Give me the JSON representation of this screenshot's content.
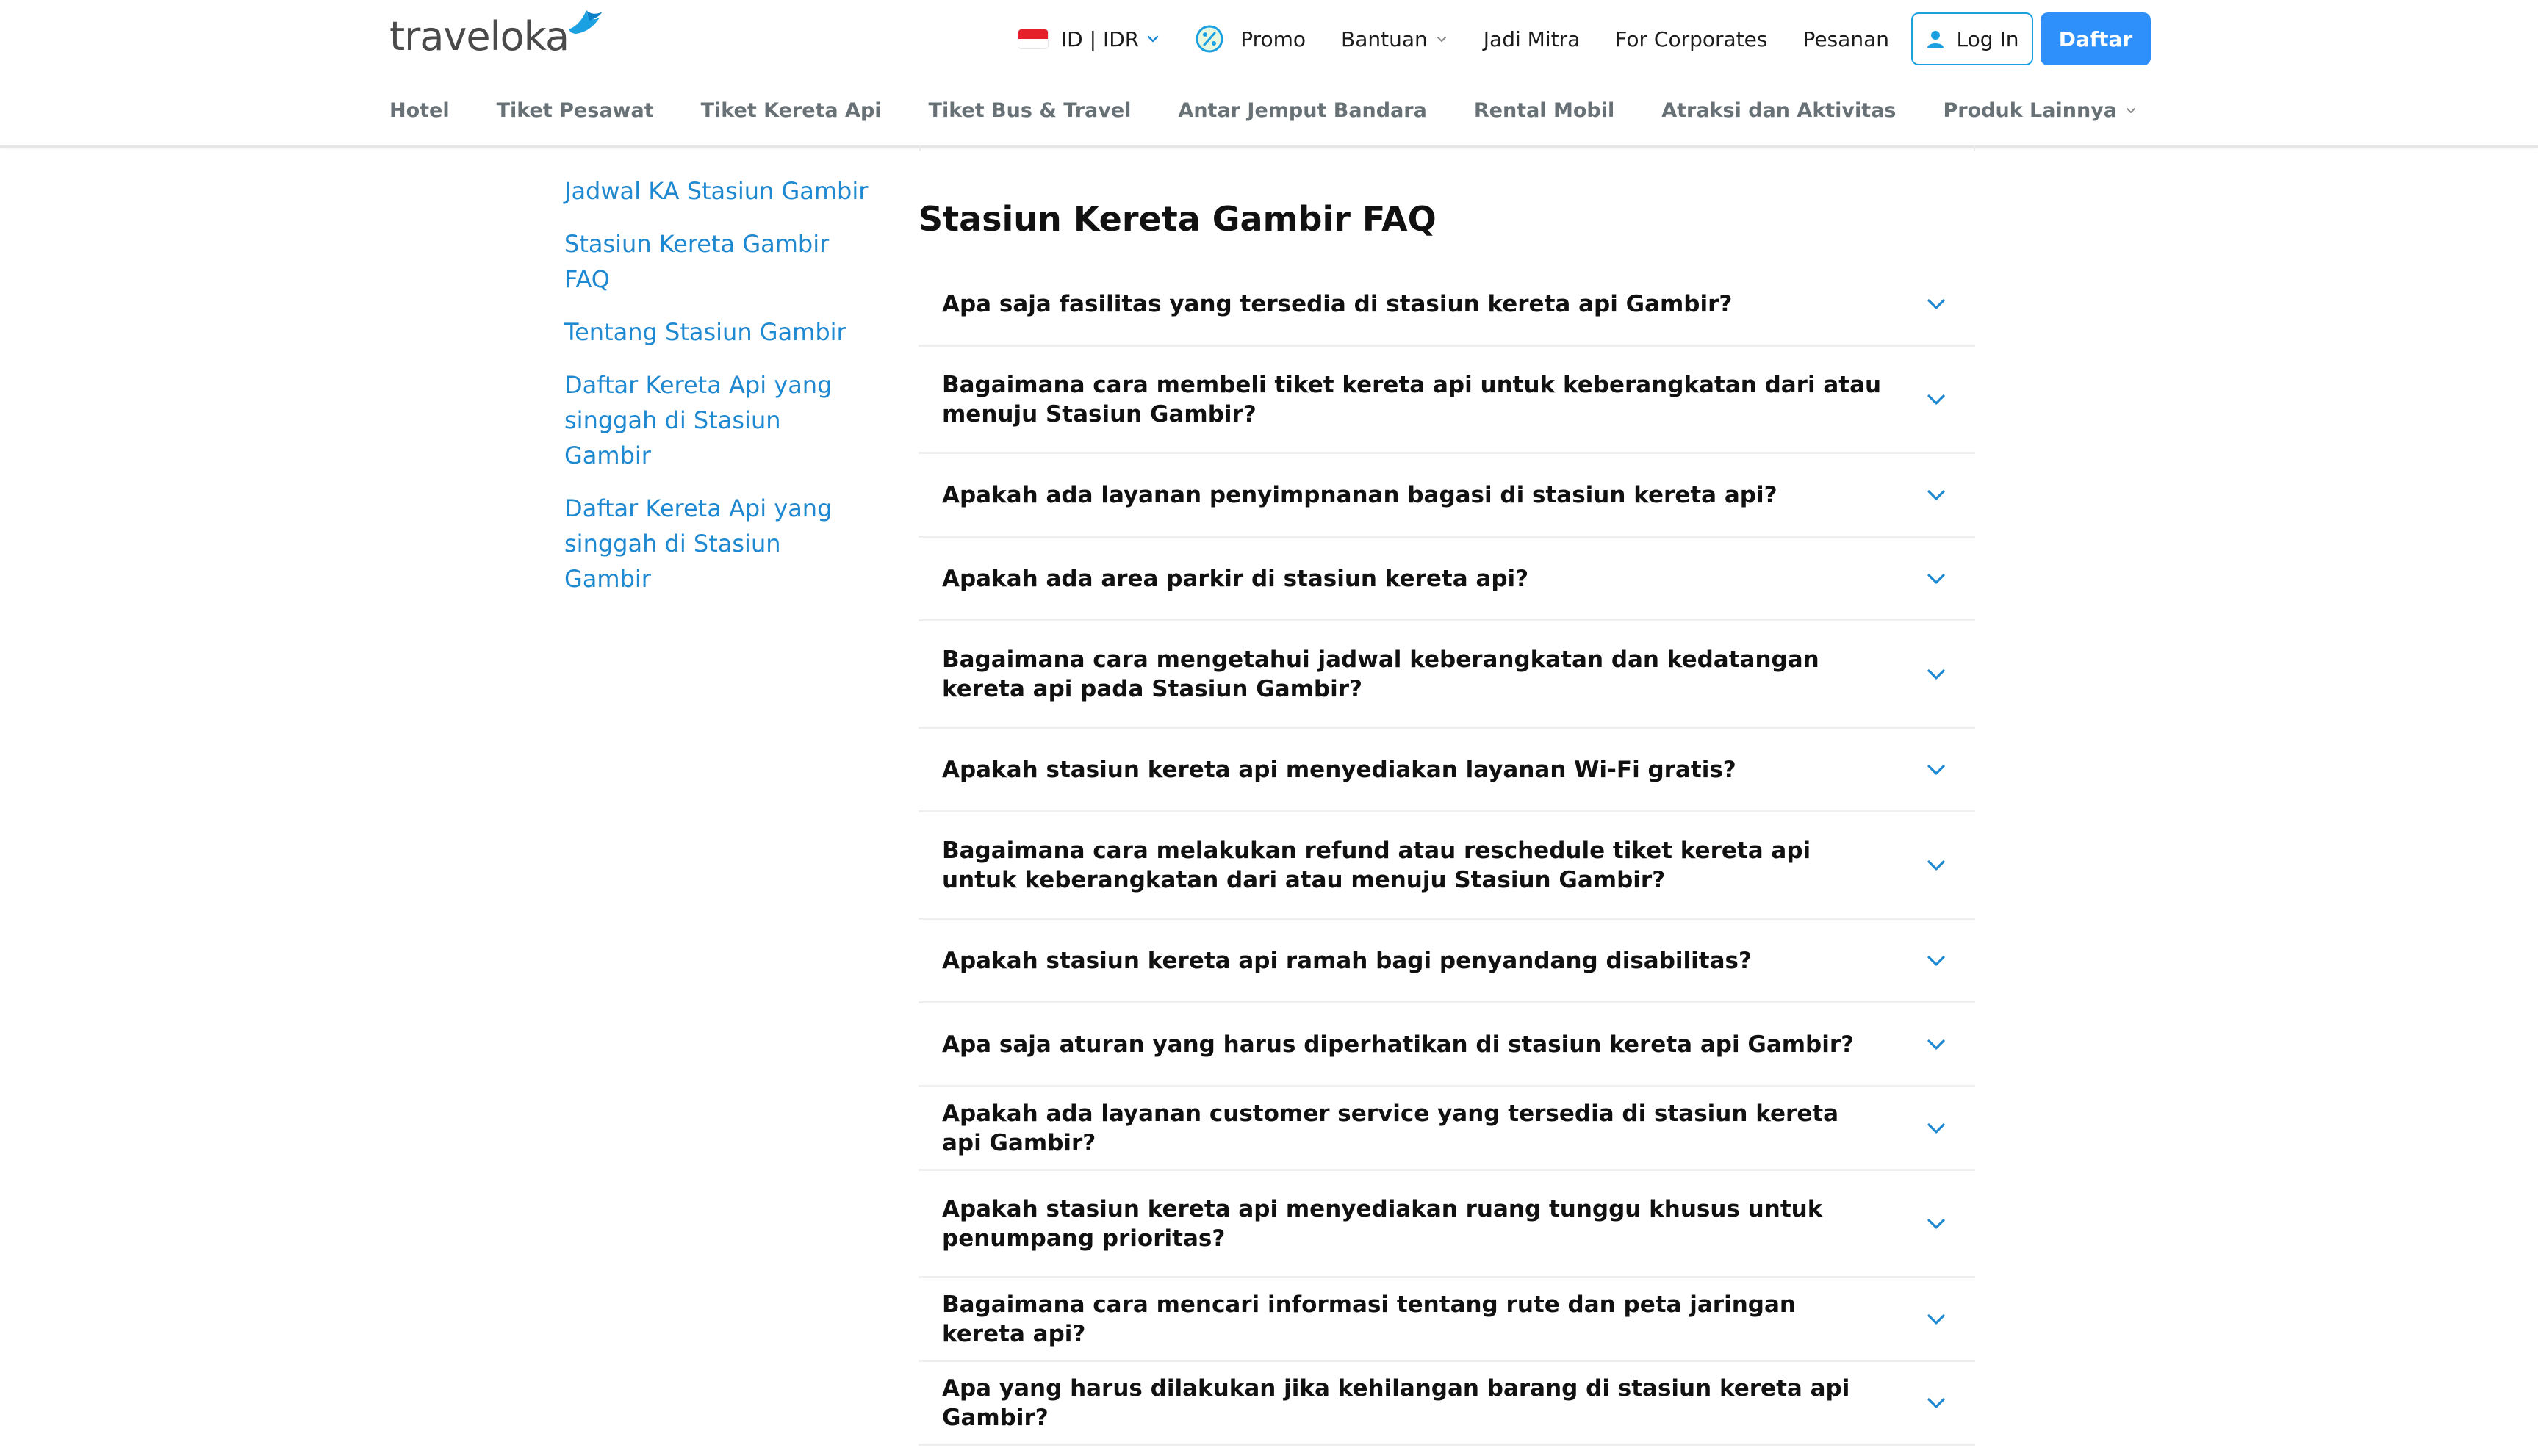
{
  "header": {
    "logo_text": "traveloka",
    "locale_label": "ID | IDR",
    "promo_label": "Promo",
    "help_label": "Bantuan",
    "partner_label": "Jadi Mitra",
    "corporate_label": "For Corporates",
    "orders_label": "Pesanan",
    "login_label": "Log In",
    "register_label": "Daftar",
    "accent_color": "#2e90fa"
  },
  "nav": {
    "items": [
      "Hotel",
      "Tiket Pesawat",
      "Tiket Kereta Api",
      "Tiket Bus & Travel",
      "Antar Jemput Bandara",
      "Rental Mobil",
      "Atraksi dan Aktivitas",
      "Produk Lainnya"
    ]
  },
  "sidebar": {
    "links": [
      "Jadwal KA Stasiun Gambir",
      "Stasiun Kereta Gambir FAQ",
      "Tentang Stasiun Gambir",
      "Daftar Kereta Api yang singgah di Stasiun Gambir",
      "Daftar Kereta Api yang singgah di Stasiun Gambir"
    ],
    "link_color": "#1e88d0"
  },
  "faq": {
    "title": "Stasiun Kereta Gambir FAQ",
    "questions": [
      "Apa saja fasilitas yang tersedia di stasiun kereta api Gambir?",
      "Bagaimana cara membeli tiket kereta api untuk keberangkatan dari atau menuju Stasiun Gambir?",
      "Apakah ada layanan penyimpnanan bagasi di stasiun kereta api?",
      "Apakah ada area parkir di stasiun kereta api?",
      "Bagaimana cara mengetahui jadwal keberangkatan dan kedatangan kereta api pada Stasiun Gambir?",
      "Apakah stasiun kereta api menyediakan layanan Wi-Fi gratis?",
      "Bagaimana cara melakukan refund atau reschedule tiket kereta api untuk keberangkatan dari atau menuju Stasiun Gambir?",
      "Apakah stasiun kereta api ramah bagi penyandang disabilitas?",
      "Apa saja aturan yang harus diperhatikan di stasiun kereta api Gambir?",
      "Apakah ada layanan customer service yang tersedia di stasiun kereta api Gambir?",
      "Apakah stasiun kereta api menyediakan ruang tunggu khusus untuk penumpang prioritas?",
      "Bagaimana cara mencari informasi tentang rute dan peta jaringan kereta api?",
      "Apa yang harus dilakukan jika kehilangan barang di stasiun kereta api Gambir?"
    ],
    "chevron_icon": "chevron-down-icon",
    "chevron_color": "#1e88d0"
  }
}
